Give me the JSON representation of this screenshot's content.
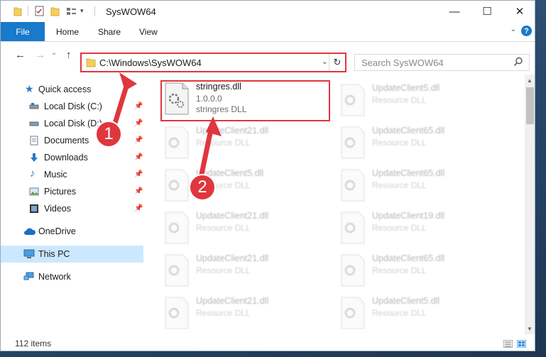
{
  "window": {
    "title": "SysWOW64",
    "minimize_glyph": "—",
    "maximize_glyph": "☐",
    "close_glyph": "✕"
  },
  "ribbon": {
    "file": "File",
    "home": "Home",
    "share": "Share",
    "view": "View",
    "help": "?"
  },
  "nav": {
    "back": "←",
    "forward": "→",
    "recent": "⌄",
    "up": "↑",
    "address": "C:\\Windows\\SysWOW64",
    "refresh": "↻",
    "dropdown": "⌄",
    "search_placeholder": "Search SysWOW64"
  },
  "sidebar": {
    "quick_access": "Quick access",
    "items": [
      {
        "label": "Local Disk (C:)",
        "icon": "drive-icon"
      },
      {
        "label": "Local Disk (D:)",
        "icon": "drive-icon"
      },
      {
        "label": "Documents",
        "icon": "documents-icon"
      },
      {
        "label": "Downloads",
        "icon": "downloads-icon"
      },
      {
        "label": "Music",
        "icon": "music-icon"
      },
      {
        "label": "Pictures",
        "icon": "pictures-icon"
      },
      {
        "label": "Videos",
        "icon": "videos-icon"
      }
    ],
    "onedrive": "OneDrive",
    "this_pc": "This PC",
    "network": "Network"
  },
  "files": {
    "selected": {
      "name": "stringres.dll",
      "version": "1.0.0.0",
      "desc": "stringres DLL"
    },
    "left": [
      {
        "name": "UpdateClient21.dll",
        "desc": "Resource DLL"
      },
      {
        "name": "UpdateClient5.dll",
        "desc": "Resource DLL"
      },
      {
        "name": "UpdateClient21.dll",
        "desc": "Resource DLL"
      },
      {
        "name": "UpdateClient21.dll",
        "desc": "Resource DLL"
      },
      {
        "name": "UpdateClient21.dll",
        "desc": "Resource DLL"
      }
    ],
    "right": [
      {
        "name": "UpdateClient5.dll",
        "desc": "Resource DLL"
      },
      {
        "name": "UpdateClient65.dll",
        "desc": "Resource DLL"
      },
      {
        "name": "UpdateClient65.dll",
        "desc": "Resource DLL"
      },
      {
        "name": "UpdateClient19.dll",
        "desc": "Resource DLL"
      },
      {
        "name": "UpdateClient65.dll",
        "desc": "Resource DLL"
      },
      {
        "name": "UpdateClient5.dll",
        "desc": "Resource DLL"
      }
    ]
  },
  "annotations": {
    "step1": "1",
    "step2": "2"
  },
  "status": {
    "items": "112 items"
  },
  "colors": {
    "accent": "#1979ca",
    "highlight": "#e0363d",
    "selected_bg": "#cce8ff"
  }
}
